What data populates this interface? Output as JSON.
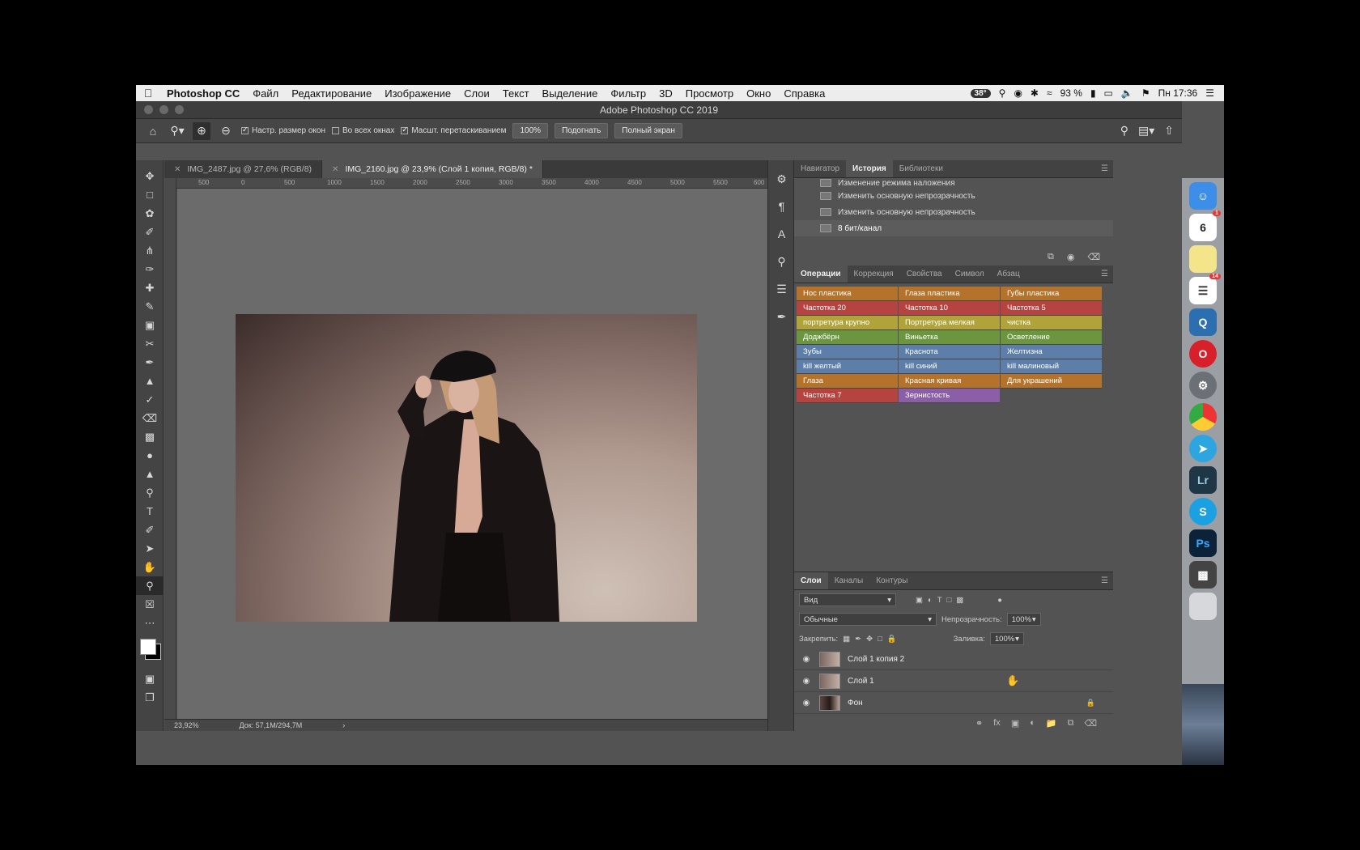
{
  "menubar": {
    "app_name": "Photoshop CC",
    "items": [
      "Файл",
      "Редактирование",
      "Изображение",
      "Слои",
      "Текст",
      "Выделение",
      "Фильтр",
      "3D",
      "Просмотр",
      "Окно",
      "Справка"
    ],
    "temperature": "38°",
    "battery": "93 %",
    "clock": "Пн 17:36"
  },
  "window": {
    "title": "Adobe Photoshop CC 2019"
  },
  "options": {
    "resize_windows": "Настр. размер окон",
    "all_windows": "Во всех окнах",
    "scrubby_zoom": "Масшт. перетаскиванием",
    "zoom_value": "100%",
    "fit_button": "Подогнать",
    "fullscreen_button": "Полный экран"
  },
  "doc_tabs": [
    {
      "label": "IMG_2487.jpg @ 27,6% (RGB/8)"
    },
    {
      "label": "IMG_2160.jpg @ 23,9% (Слой 1 копия, RGB/8) *"
    }
  ],
  "ruler_ticks": [
    "500",
    "0",
    "500",
    "1000",
    "1500",
    "2000",
    "2500",
    "3000",
    "3500",
    "4000",
    "4500",
    "5000",
    "5500",
    "600"
  ],
  "status": {
    "zoom": "23,92%",
    "doc": "Док: 57,1M/294,7M",
    "arrow": "›"
  },
  "history_panel": {
    "tabs": [
      "Навигатор",
      "История",
      "Библиотеки"
    ],
    "rows": [
      {
        "label": "Изменение режима наложения"
      },
      {
        "label": "Изменить основную непрозрачность"
      },
      {
        "label": "Изменить основную непрозрачность"
      },
      {
        "label": "8 бит/канал"
      }
    ]
  },
  "actions_panel": {
    "tabs": [
      "Операции",
      "Коррекция",
      "Свойства",
      "Символ",
      "Абзац"
    ],
    "buttons": [
      {
        "label": "Нос пластика",
        "color": "#b5722a"
      },
      {
        "label": "Глаза пластика",
        "color": "#b5722a"
      },
      {
        "label": "Губы пластика",
        "color": "#b5722a"
      },
      {
        "label": "Частотка 20",
        "color": "#b54340"
      },
      {
        "label": "Частотка 10",
        "color": "#b54340"
      },
      {
        "label": "Частотка 5",
        "color": "#b54340"
      },
      {
        "label": "портретура крупно",
        "color": "#b0a33a"
      },
      {
        "label": "Портретура мелкая",
        "color": "#b0a33a"
      },
      {
        "label": "чистка",
        "color": "#b0a33a"
      },
      {
        "label": "Доджбёрн",
        "color": "#6b963f"
      },
      {
        "label": "Виньетка",
        "color": "#6b963f"
      },
      {
        "label": "Осветление",
        "color": "#6b963f"
      },
      {
        "label": "Зубы",
        "color": "#5d7ea8"
      },
      {
        "label": "Краснота",
        "color": "#5d7ea8"
      },
      {
        "label": "Желтизна",
        "color": "#5d7ea8"
      },
      {
        "label": "kill желтый",
        "color": "#5d7ea8"
      },
      {
        "label": "kill синий",
        "color": "#5d7ea8"
      },
      {
        "label": "kill малиновый",
        "color": "#5d7ea8"
      },
      {
        "label": "Глаза",
        "color": "#b5722a"
      },
      {
        "label": "Красная кривая",
        "color": "#b5722a"
      },
      {
        "label": "Для украшений",
        "color": "#b5722a"
      },
      {
        "label": "Частотка 7",
        "color": "#b54340"
      },
      {
        "label": "Зернистость",
        "color": "#8a5fa8"
      }
    ]
  },
  "layers_panel": {
    "tabs": [
      "Слои",
      "Каналы",
      "Контуры"
    ],
    "filter": "Вид",
    "blend_mode": "Обычные",
    "opacity_label": "Непрозрачность:",
    "opacity_value": "100%",
    "lock_label": "Закрепить:",
    "fill_label": "Заливка:",
    "fill_value": "100%",
    "layers": [
      {
        "name": "Слой 1 копия 2"
      },
      {
        "name": "Слой 1"
      },
      {
        "name": "Фон"
      }
    ]
  },
  "dock": {
    "calendar_day": "6",
    "calendar_badge": "1",
    "reminders_badge": "14",
    "apps": [
      "Lr",
      "S",
      "Ps"
    ]
  }
}
